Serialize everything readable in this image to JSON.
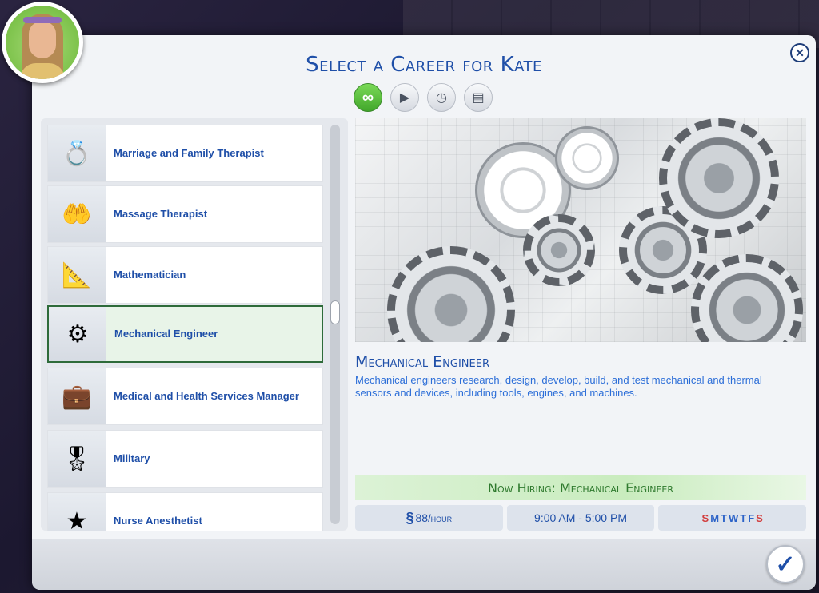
{
  "dialog": {
    "title": "Select a Career for Kate",
    "close_icon": "close-icon",
    "confirm_icon": "checkmark-icon"
  },
  "filters": [
    {
      "name": "all-careers",
      "icon": "infinity-icon",
      "glyph": "∞",
      "active": true
    },
    {
      "name": "full-time",
      "icon": "briefcase-play-icon",
      "glyph": "▶",
      "active": false
    },
    {
      "name": "part-time",
      "icon": "briefcase-clock-icon",
      "glyph": "◷",
      "active": false
    },
    {
      "name": "odd-jobs",
      "icon": "briefcase-stack-icon",
      "glyph": "▤",
      "active": false
    }
  ],
  "careers": [
    {
      "label": "Marriage and Family Therapist",
      "icon": "rings-icon",
      "glyph": "💍"
    },
    {
      "label": "Massage Therapist",
      "icon": "hands-icon",
      "glyph": "🤲"
    },
    {
      "label": "Mathematician",
      "icon": "chalkboard-icon",
      "glyph": "📐"
    },
    {
      "label": "Mechanical Engineer",
      "icon": "gears-icon",
      "glyph": "⚙",
      "selected": true
    },
    {
      "label": "Medical and Health Services Manager",
      "icon": "briefcase-icon",
      "glyph": "💼"
    },
    {
      "label": "Military",
      "icon": "chevron-rank-icon",
      "glyph": "🎖"
    },
    {
      "label": "Nurse Anesthetist",
      "icon": "star-icon",
      "glyph": "★"
    }
  ],
  "detail": {
    "title": "Mechanical Engineer",
    "description": "Mechanical engineers research, design, develop, build, and test mechanical and thermal sensors and devices, including tools, engines, and machines.",
    "hiring": "Now Hiring: Mechanical Engineer",
    "pay_symbol": "§",
    "pay_amount": "88",
    "pay_unit": "/hour",
    "hours": "9:00  AM - 5:00  PM",
    "days": [
      "S",
      "M",
      "T",
      "W",
      "T",
      "F",
      "S"
    ]
  },
  "colors": {
    "accent_blue": "#1f4fa8",
    "active_green": "#42a72b",
    "weekend_red": "#d23c3c"
  }
}
